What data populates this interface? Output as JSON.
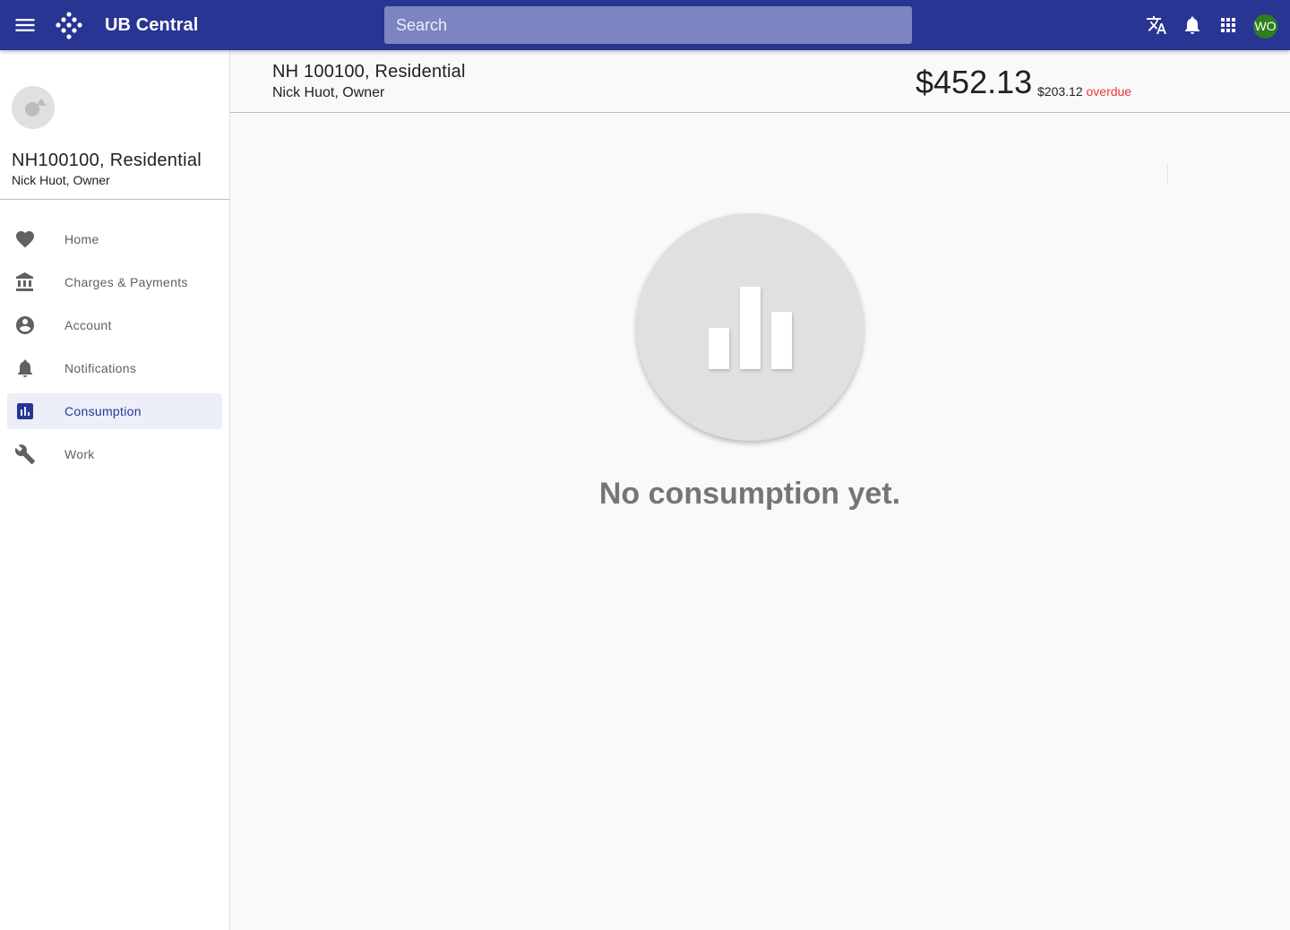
{
  "topbar": {
    "app_title": "UB Central",
    "search_placeholder": "Search",
    "user_initials": "WO",
    "icons": [
      "menu-icon",
      "logo-icon",
      "translate-icon",
      "bell-icon",
      "apps-grid-icon"
    ]
  },
  "sidebar": {
    "account_name": "NH100100, Residential",
    "account_owner": "Nick Huot, Owner",
    "items": [
      {
        "label": "Home",
        "icon": "heart-icon",
        "active": false
      },
      {
        "label": "Charges & Payments",
        "icon": "bank-icon",
        "active": false
      },
      {
        "label": "Account",
        "icon": "account-circle-icon",
        "active": false
      },
      {
        "label": "Notifications",
        "icon": "bell-icon",
        "active": false
      },
      {
        "label": "Consumption",
        "icon": "bar-chart-icon",
        "active": true
      },
      {
        "label": "Work",
        "icon": "wrench-icon",
        "active": false
      }
    ]
  },
  "header": {
    "title": "NH 100100, Residential",
    "owner": "Nick Huot, Owner",
    "balance": "$452.13",
    "overdue_amount": "$203.12",
    "overdue_label": "overdue"
  },
  "main": {
    "empty_message": "No consumption yet."
  },
  "colors": {
    "primary": "#283593",
    "search_bg": "#7c84c1",
    "active_nav_bg": "#eceef8",
    "overdue": "#e53935",
    "avatar_bg": "#2e7d1e"
  }
}
